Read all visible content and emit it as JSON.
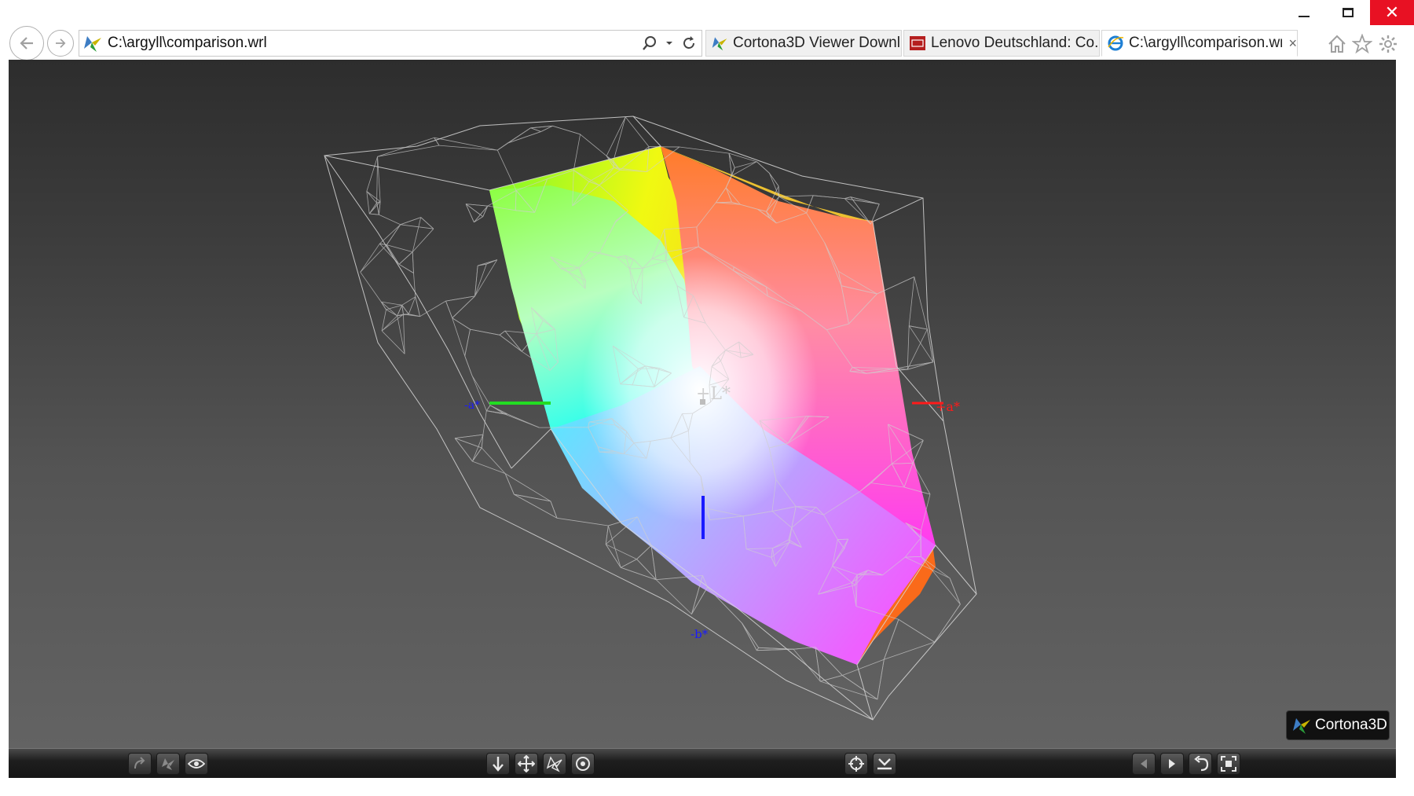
{
  "window": {
    "minimize_icon": "minimize-icon",
    "maximize_icon": "maximize-icon",
    "close_icon": "close-icon",
    "close_color": "#e81123"
  },
  "nav": {
    "back_icon": "back-arrow-icon",
    "forward_icon": "forward-arrow-icon"
  },
  "address": {
    "value": "C:\\argyll\\comparison.wrl",
    "search_icon": "search-icon",
    "dropdown_icon": "chevron-down-icon",
    "refresh_icon": "refresh-icon"
  },
  "tabs": [
    {
      "label": "Cortona3D Viewer Downl...",
      "icon": "cortona-icon"
    },
    {
      "label": "Lenovo Deutschland: Co...",
      "icon": "lenovo-icon"
    },
    {
      "label": "C:\\argyll\\comparison.wrl",
      "icon": "ie-icon",
      "active": true,
      "close": "×"
    }
  ],
  "right_icons": [
    "home-icon",
    "star-icon",
    "gear-icon"
  ],
  "scene": {
    "axis_labels": {
      "l": "+L*",
      "a_pos": "+a*",
      "a_neg": "-a*",
      "b_neg": "-b*"
    },
    "axis_colors": {
      "a_pos": "#ff1a1a",
      "a_neg": "#22dd22",
      "b": "#1a1aff",
      "l": "#cfcfcf"
    }
  },
  "logo": {
    "text": "Cortona3D"
  },
  "toolbar": {
    "left": [
      "redo-icon",
      "plane-icon",
      "eye-icon"
    ],
    "center": [
      "walk-icon",
      "pan-icon",
      "fly-icon",
      "rotate-icon"
    ],
    "mid": [
      "target-icon",
      "align-icon"
    ],
    "right": [
      "previous-icon",
      "next-icon",
      "undo-icon",
      "fit-icon"
    ]
  }
}
